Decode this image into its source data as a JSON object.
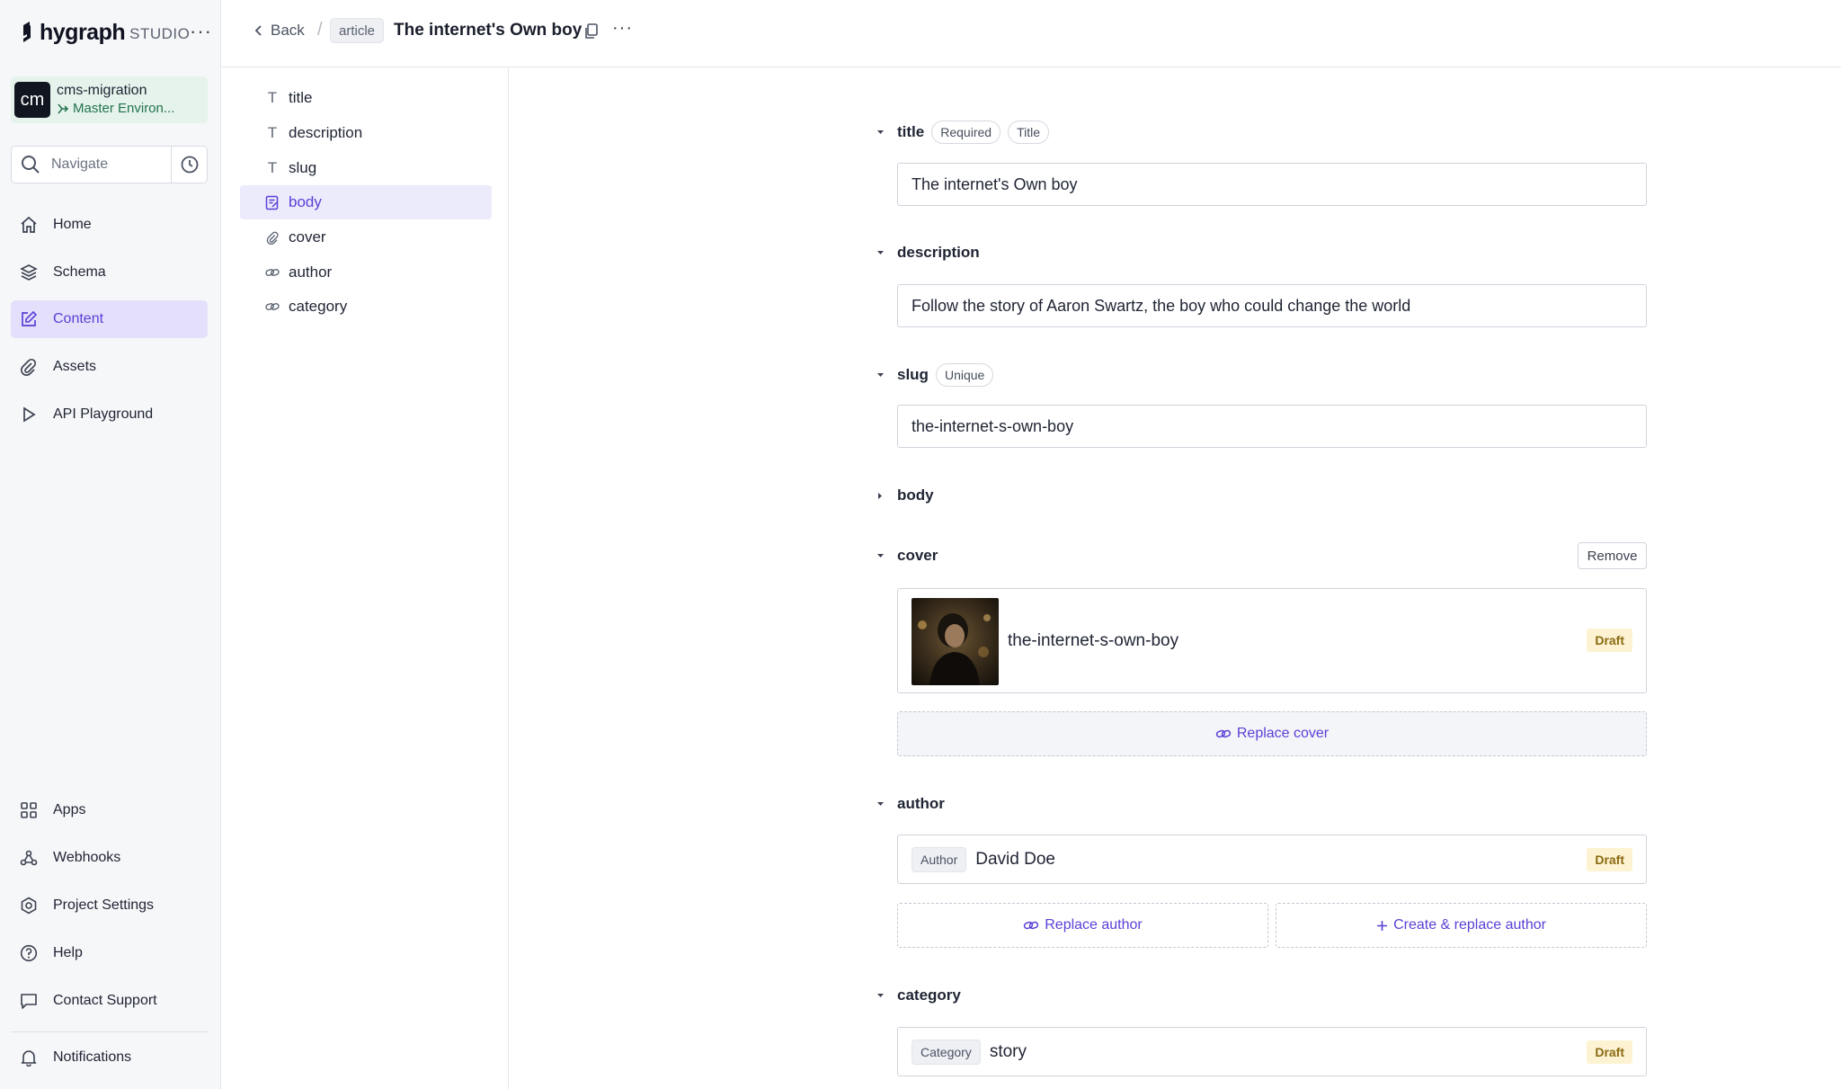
{
  "brand": {
    "name": "hygraph",
    "product": "STUDIO",
    "menu": "···"
  },
  "project": {
    "initials": "cm",
    "name": "cms-migration",
    "environment": "Master Environ..."
  },
  "search": {
    "placeholder": "Navigate"
  },
  "nav": {
    "home": "Home",
    "schema": "Schema",
    "content": "Content",
    "assets": "Assets",
    "api_playground": "API Playground",
    "apps": "Apps",
    "webhooks": "Webhooks",
    "project_settings": "Project Settings",
    "help": "Help",
    "contact_support": "Contact Support",
    "notifications": "Notifications"
  },
  "nav_icons": [
    "home-icon",
    "layers-icon",
    "edit-icon",
    "paperclip-icon",
    "play-icon",
    "grid-icon",
    "webhook-icon",
    "gear-icon",
    "help-icon",
    "chat-icon",
    "bell-icon"
  ],
  "header": {
    "back": "Back",
    "separator": "/",
    "model": "article",
    "title": "The internet's Own boy",
    "more": "···"
  },
  "field_list": [
    {
      "name": "title",
      "icon": "text-icon"
    },
    {
      "name": "description",
      "icon": "text-icon"
    },
    {
      "name": "slug",
      "icon": "text-icon"
    },
    {
      "name": "body",
      "icon": "rich-text-icon",
      "active": true
    },
    {
      "name": "cover",
      "icon": "paperclip-icon"
    },
    {
      "name": "author",
      "icon": "link-icon"
    },
    {
      "name": "category",
      "icon": "link-icon"
    }
  ],
  "form": {
    "title": {
      "label": "title",
      "badges": [
        "Required",
        "Title"
      ],
      "value": "The internet's Own boy"
    },
    "description": {
      "label": "description",
      "value": "Follow the story of Aaron Swartz, the boy who could change the world"
    },
    "slug": {
      "label": "slug",
      "badges": [
        "Unique"
      ],
      "value": "the-internet-s-own-boy"
    },
    "body": {
      "label": "body"
    },
    "cover": {
      "label": "cover",
      "remove": "Remove",
      "asset_name": "the-internet-s-own-boy",
      "status": "Draft",
      "replace": "Replace cover"
    },
    "author": {
      "label": "author",
      "type": "Author",
      "name": "David Doe",
      "status": "Draft",
      "replace": "Replace author",
      "create_replace": "Create & replace author"
    },
    "category": {
      "label": "category",
      "type": "Category",
      "name": "story",
      "status": "Draft"
    }
  },
  "colors": {
    "accent": "#5b3fd6",
    "active_bg": "#e4dffb",
    "draft_bg": "#fdf3d2",
    "draft_text": "#8a6a12",
    "project_bg": "#e5f3ec",
    "env_text": "#22734c"
  }
}
